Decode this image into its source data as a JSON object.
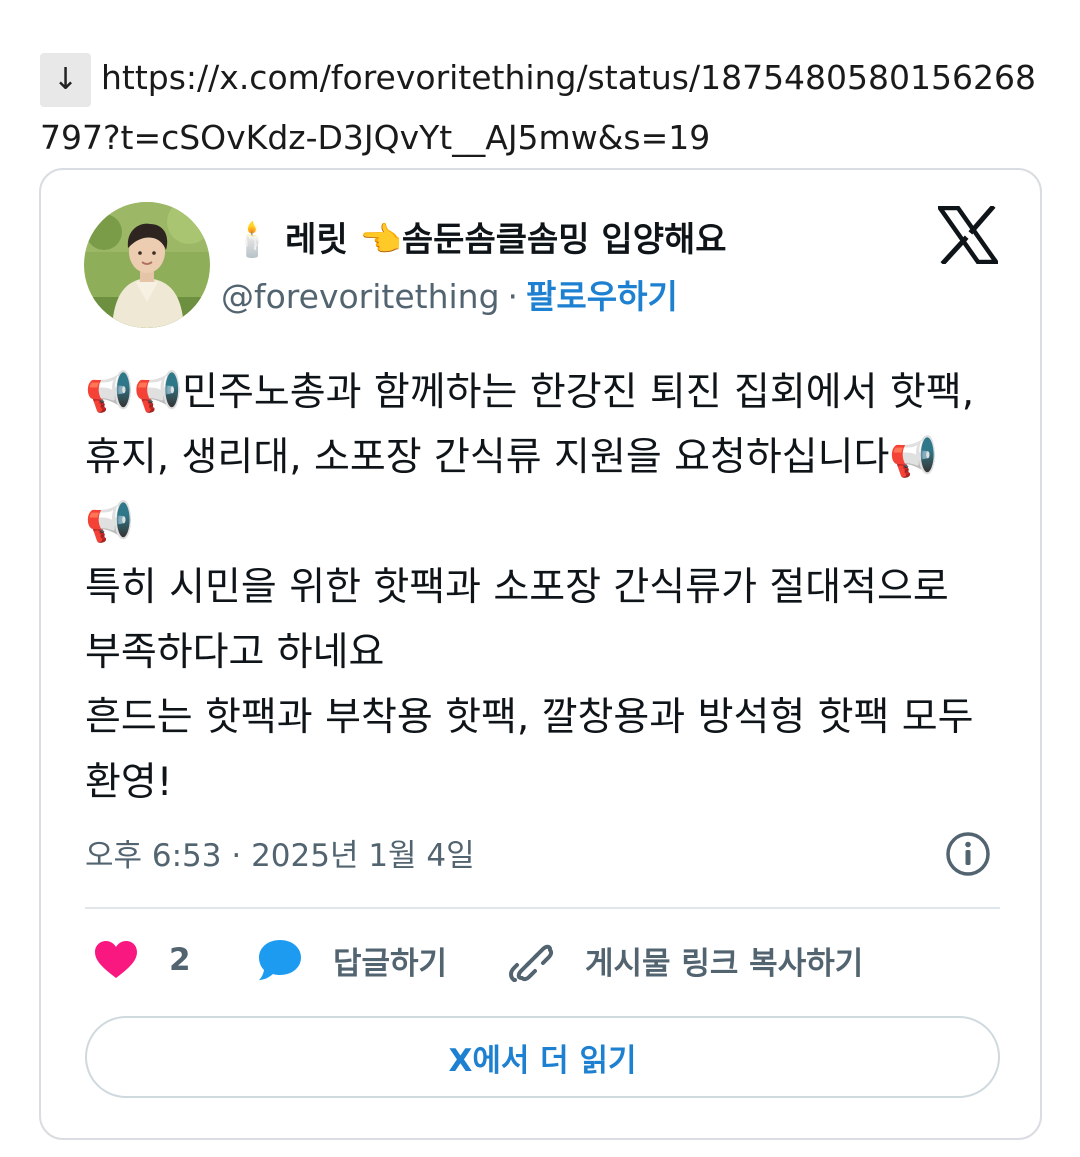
{
  "page": {
    "arrow_glyph": "↓",
    "url": "https://x.com/forevoritething/status/1875480580156268797?t=cSOvKdz-D3JQvYt__AJ5mw&s=19"
  },
  "tweet": {
    "display_name": "🕯️ 레릿 👈솜둔솜클솜밍 입양해요",
    "handle": "@forevoritething",
    "separator": "·",
    "follow_label": "팔로우하기",
    "text": "📢📢민주노총과 함께하는 한강진 퇴진 집회에서 핫팩, 휴지, 생리대, 소포장 간식류 지원을 요청하십니다📢📢\n특히 시민을 위한 핫팩과 소포장 간식류가 절대적으로 부족하다고 하네요\n흔드는 핫팩과 부착용 핫팩, 깔창용과 방석형 핫팩 모두 환영!",
    "timestamp": "오후 6:53 · 2025년 1월 4일",
    "like_count": "2",
    "reply_label": "답글하기",
    "copy_link_label": "게시물 링크 복사하기",
    "read_more_label": "X에서 더 읽기"
  },
  "colors": {
    "accent_blue": "#1d80d0",
    "like_pink": "#f91880",
    "reply_blue": "#1d9bf0",
    "muted_gray": "#536471"
  },
  "icons": {
    "logo": "x-logo-icon",
    "info": "info-icon",
    "like": "heart-icon",
    "reply": "speech-bubble-icon",
    "copy": "link-icon",
    "download": "down-arrow-icon"
  }
}
